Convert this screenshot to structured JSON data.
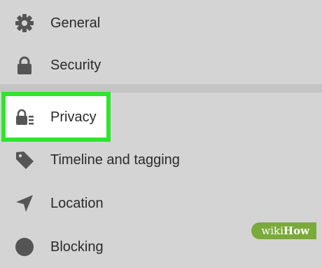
{
  "menu": {
    "items": [
      {
        "label": "General",
        "icon": "gear-icon"
      },
      {
        "label": "Security",
        "icon": "padlock-icon"
      },
      {
        "label": "Privacy",
        "icon": "privacy-lock-icon"
      },
      {
        "label": "Timeline and tagging",
        "icon": "tag-icon"
      },
      {
        "label": "Location",
        "icon": "location-arrow-icon"
      },
      {
        "label": "Blocking",
        "icon": "block-icon"
      }
    ]
  },
  "highlight_color": "#2ee52e",
  "watermark": {
    "prefix": "wiki",
    "suffix": "How"
  }
}
